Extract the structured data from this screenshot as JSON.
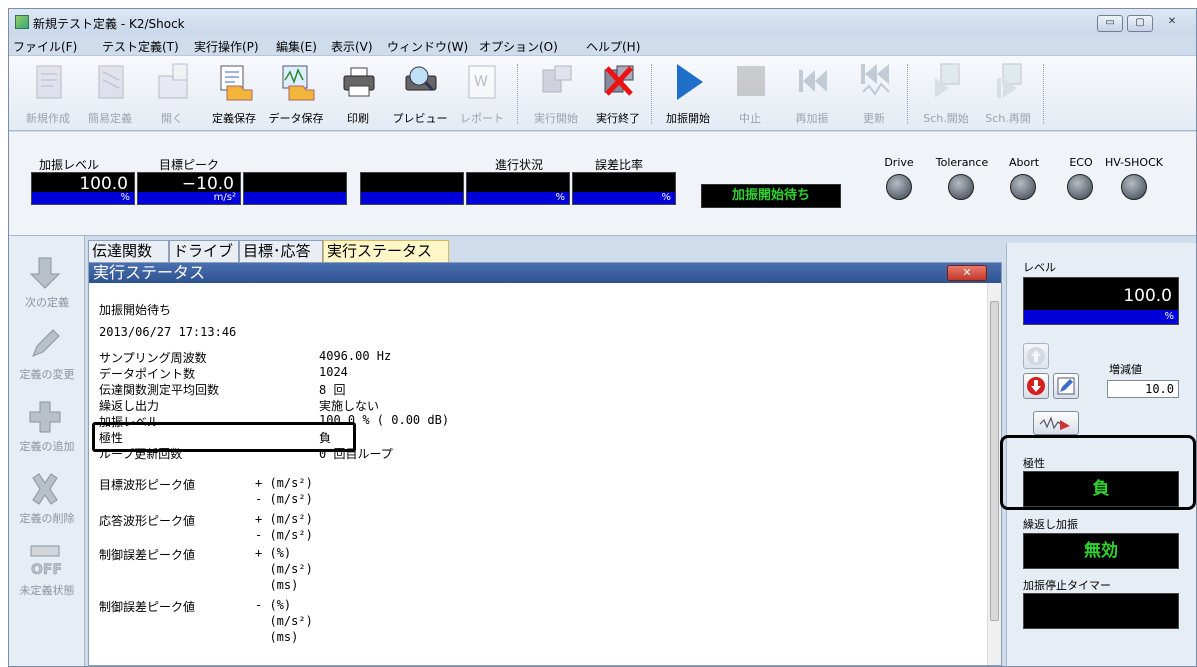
{
  "window": {
    "title": "新規テスト定義 - K2/Shock"
  },
  "menu": [
    "ファイル(F)",
    "テスト定義(T)",
    "実行操作(P)",
    "編集(E)",
    "表示(V)",
    "ウィンドウ(W)",
    "オプション(O)",
    "ヘルプ(H)"
  ],
  "toolbar": [
    {
      "label": "新規作成",
      "icon": "new-file-icon",
      "enabled": false
    },
    {
      "label": "簡易定義",
      "icon": "simple-define-icon",
      "enabled": false
    },
    {
      "label": "開く",
      "icon": "open-icon",
      "enabled": false
    },
    {
      "label": "定義保存",
      "icon": "save-definition-icon",
      "enabled": true
    },
    {
      "label": "データ保存",
      "icon": "save-data-icon",
      "enabled": true
    },
    {
      "label": "印刷",
      "icon": "printer-icon",
      "enabled": true
    },
    {
      "label": "プレビュー",
      "icon": "preview-icon",
      "enabled": true
    },
    {
      "label": "レポート",
      "icon": "word-report-icon",
      "enabled": false
    },
    {
      "label": "実行開始",
      "icon": "run-start-icon",
      "enabled": false
    },
    {
      "label": "実行終了",
      "icon": "run-stop-icon",
      "enabled": true
    },
    {
      "label": "加振開始",
      "icon": "play-icon",
      "enabled": true
    },
    {
      "label": "中止",
      "icon": "stop-icon",
      "enabled": false
    },
    {
      "label": "再加振",
      "icon": "rewind-icon",
      "enabled": false
    },
    {
      "label": "更新",
      "icon": "update-icon",
      "enabled": false
    },
    {
      "label": "Sch.開始",
      "icon": "schedule-start-icon",
      "enabled": false
    },
    {
      "label": "Sch.再開",
      "icon": "schedule-resume-icon",
      "enabled": false
    }
  ],
  "status": {
    "level_label": "加振レベル",
    "level_value": "100.0",
    "level_unit": "%",
    "target_peak_label": "目標ピーク",
    "target_peak_value": "−10.0",
    "target_peak_unit": "m/s²",
    "progress_label": "進行状況",
    "progress_unit": "%",
    "error_ratio_label": "誤差比率",
    "error_ratio_unit": "%",
    "message": "加振開始待ち",
    "leds": [
      "Drive",
      "Tolerance",
      "Abort",
      "ECO",
      "HV-SHOCK"
    ]
  },
  "left_panel": [
    {
      "label": "次の定義",
      "icon": "arrow-down-icon"
    },
    {
      "label": "定義の変更",
      "icon": "pencil-icon"
    },
    {
      "label": "定義の追加",
      "icon": "plus-icon"
    },
    {
      "label": "定義の削除",
      "icon": "delete-x-icon"
    },
    {
      "label": "未定義状態",
      "icon": "off-icon"
    }
  ],
  "tabs": [
    "伝達関数",
    "ドライブ",
    "目標･応答",
    "実行ステータス"
  ],
  "content": {
    "title": "実行ステータス",
    "status_line": "加振開始待ち",
    "datetime": "2013/06/27 17:13:46",
    "rows": [
      {
        "label": "サンプリング周波数",
        "value": "4096.00 Hz"
      },
      {
        "label": "データポイント数",
        "value": "1024"
      },
      {
        "label": "伝達関数測定平均回数",
        "value": "8 回"
      },
      {
        "label": "繰返し出力",
        "value": "実施しない"
      },
      {
        "label": "加振レベル",
        "value": "100.0 % ( 0.00 dB)"
      },
      {
        "label": "極性",
        "value": "負"
      },
      {
        "label": "ループ更新回数",
        "value": "0 回目ループ"
      }
    ],
    "peaks": [
      {
        "label": "目標波形ピーク値",
        "lines": [
          "+ (m/s²)",
          "- (m/s²)"
        ]
      },
      {
        "label": "応答波形ピーク値",
        "lines": [
          "+ (m/s²)",
          "- (m/s²)"
        ]
      },
      {
        "label": "制御誤差ピーク値",
        "lines": [
          "+ (%)",
          "  (m/s²)",
          "  (ms)"
        ]
      },
      {
        "label": "制御誤差ピーク値",
        "lines": [
          "- (%)",
          "  (m/s²)",
          "  (ms)"
        ]
      }
    ]
  },
  "right_panel": {
    "level_label": "レベル",
    "level_value": "100.0",
    "level_unit": "%",
    "step_label": "増減値",
    "step_value": "10.0",
    "polarity_label": "極性",
    "polarity_value": "負",
    "repeat_label": "繰返し加振",
    "repeat_value": "無効",
    "timer_label": "加振停止タイマー",
    "timer_value": ""
  },
  "colors": {
    "accent_green": "#2fd12f",
    "unit_blue": "#0000d8",
    "titlebar": "#2f528f"
  }
}
